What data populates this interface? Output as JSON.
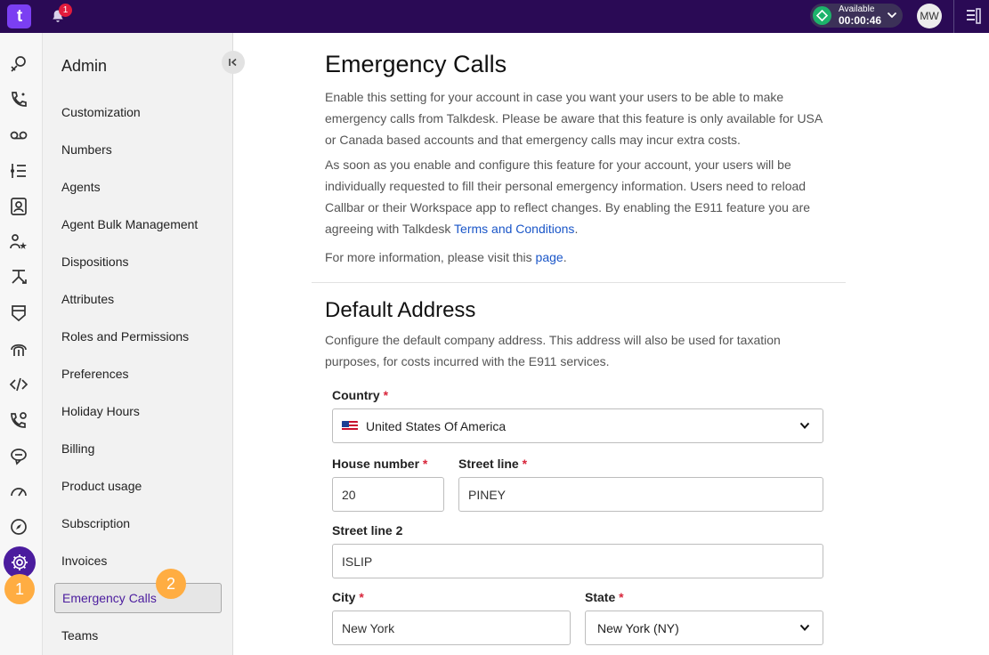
{
  "topbar": {
    "logo_text": "t",
    "notification_count": "1",
    "status_label": "Available",
    "status_timer": "00:00:46",
    "user_initials": "MW"
  },
  "callouts": {
    "first": "1",
    "second": "2"
  },
  "sidebar": {
    "title": "Admin",
    "items": [
      {
        "label": "Customization"
      },
      {
        "label": "Numbers"
      },
      {
        "label": "Agents"
      },
      {
        "label": "Agent Bulk Management"
      },
      {
        "label": "Dispositions"
      },
      {
        "label": "Attributes"
      },
      {
        "label": "Roles and Permissions"
      },
      {
        "label": "Preferences"
      },
      {
        "label": "Holiday Hours"
      },
      {
        "label": "Billing"
      },
      {
        "label": "Product usage"
      },
      {
        "label": "Subscription"
      },
      {
        "label": "Invoices"
      },
      {
        "label": "Emergency Calls"
      },
      {
        "label": "Teams"
      }
    ]
  },
  "main": {
    "title": "Emergency Calls",
    "intro": "Enable this setting for your account in case you want your users to be able to make emergency calls from Talkdesk. Please be aware that this feature is only available for USA or Canada based accounts and that emergency calls may incur extra costs.",
    "para2": "As soon as you enable and configure this feature for your account, your users will be individually requested to fill their personal emergency information. Users need to reload Callbar or their Workspace app to reflect changes. By enabling the E911 feature you are agreeing with Talkdesk ",
    "terms_link": "Terms and Conditions",
    "para2_end": ".",
    "more_info": "For more information, please visit this ",
    "page_link": "page",
    "more_info_end": ".",
    "section_title": "Default Address",
    "section_desc": "Configure the default company address. This address will also be used for taxation purposes, for costs incurred with the E911 services.",
    "form": {
      "country_label": "Country",
      "country_value": "United States Of America",
      "house_label": "House number",
      "house_value": "20",
      "street_label": "Street line",
      "street_value": "PINEY",
      "street2_label": "Street line 2",
      "street2_value": "ISLIP",
      "city_label": "City",
      "city_value": "New York",
      "state_label": "State",
      "state_value": "New York (NY)",
      "required_mark": "*"
    }
  },
  "colors": {
    "topbar": "#2a0a55",
    "accent": "#4b1c9e",
    "available": "#1db36b",
    "callout": "#ffad42",
    "link": "#1a56c8"
  }
}
